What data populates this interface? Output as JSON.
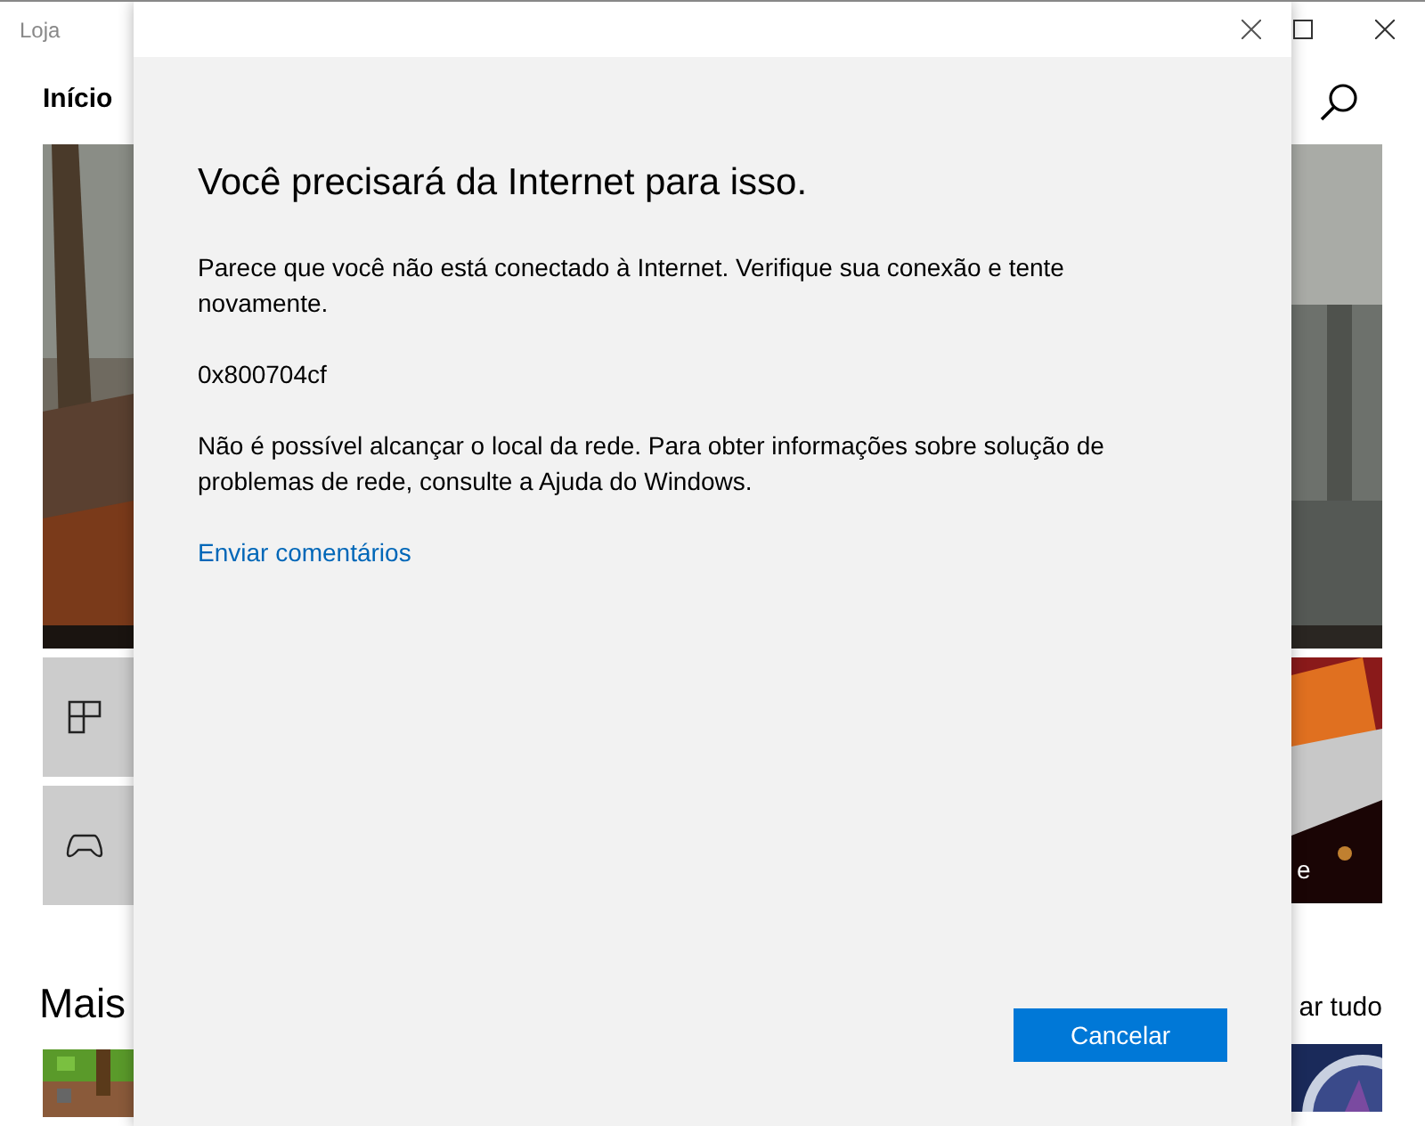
{
  "app": {
    "title": "Loja",
    "nav_item": "Início",
    "section_title": "Mais",
    "section_link": "ar tudo",
    "tile_caption": "e"
  },
  "dialog": {
    "title": "Você precisará da Internet para isso.",
    "message": "Parece que você não está conectado à Internet. Verifique sua conexão e tente novamente.",
    "error_code": "0x800704cf",
    "details": "Não é possível alcançar o local da rede. Para obter informações sobre solução de problemas de rede, consulte a Ajuda do Windows.",
    "link": "Enviar comentários",
    "button": "Cancelar"
  }
}
